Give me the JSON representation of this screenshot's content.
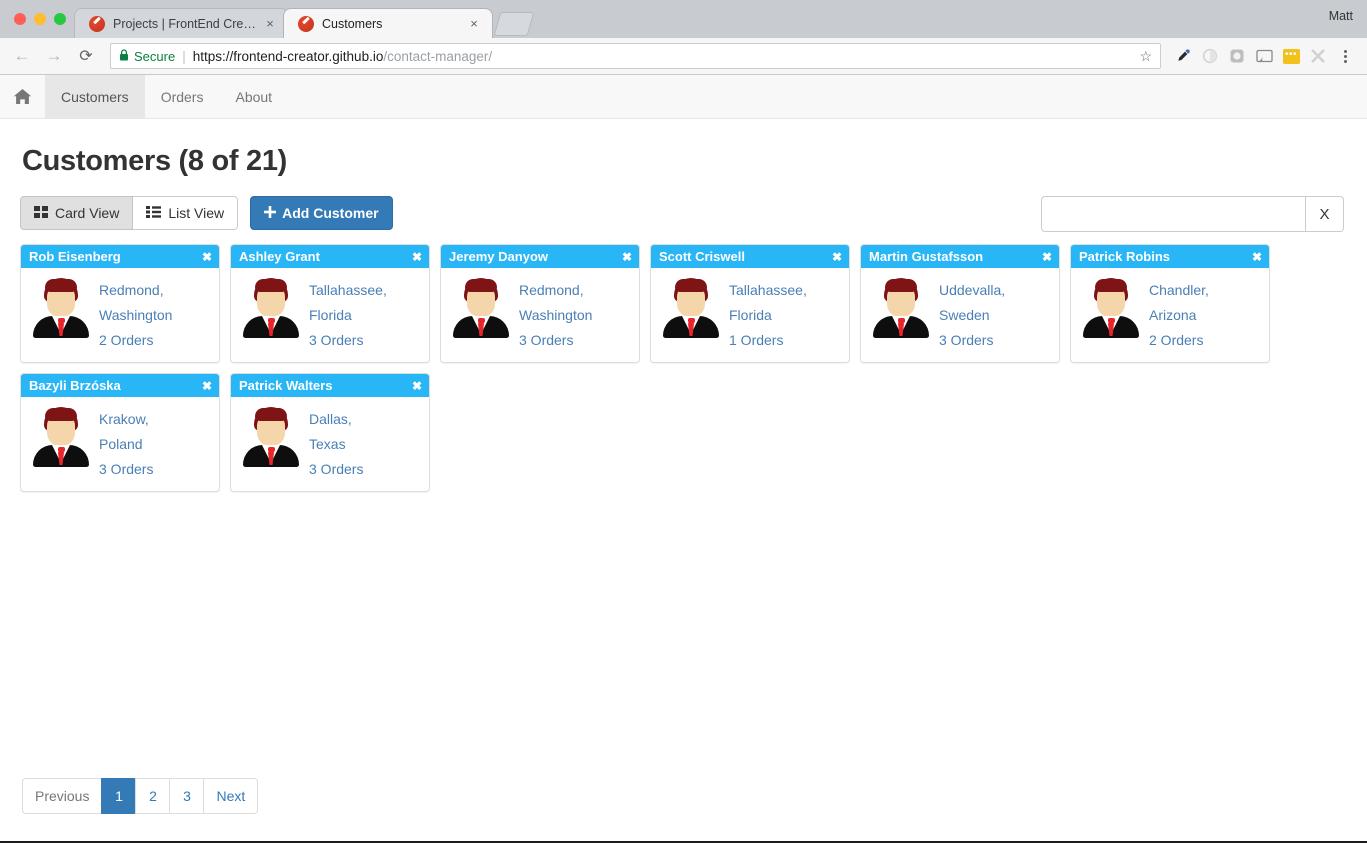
{
  "browser": {
    "user_label": "Matt",
    "tabs": [
      {
        "title": "Projects | FrontEnd Creator",
        "favicon": "aurelia-favicon",
        "close": "×",
        "active": false
      },
      {
        "title": "Customers",
        "favicon": "aurelia-favicon",
        "close": "×",
        "active": true
      }
    ],
    "omnibox": {
      "back_icon": "←",
      "forward_icon": "→",
      "reload_icon": "⟳",
      "lock_icon": "🔒",
      "secure_label": "Secure",
      "separator": "|",
      "url_host": "https://frontend-creator.github.io",
      "url_path": "/contact-manager/",
      "star_icon": "☆",
      "extensions": [
        "eyedropper-icon",
        "circle-icon",
        "square-icon",
        "cast-icon",
        "extension-badge-icon",
        "puzzle-icon"
      ],
      "badge_text": "•••",
      "menu_icon": "kebab-menu-icon"
    }
  },
  "nav": {
    "home_icon": "home-icon",
    "items": [
      {
        "label": "Customers",
        "active": true
      },
      {
        "label": "Orders",
        "active": false
      },
      {
        "label": "About",
        "active": false
      }
    ]
  },
  "main": {
    "title": "Customers (8 of 21)",
    "toolbar": {
      "card_view_label": "Card View",
      "card_view_icon": "grid-icon",
      "list_view_label": "List View",
      "list_view_icon": "list-icon",
      "add_customer_label": "Add Customer",
      "add_customer_icon": "plus-icon"
    },
    "search": {
      "value": "",
      "placeholder": "",
      "clear_label": "X"
    },
    "cards": [
      {
        "name": "Rob Eisenberg",
        "city": "Redmond,",
        "region": "Washington",
        "orders": "2 Orders",
        "close": "✖"
      },
      {
        "name": "Ashley Grant",
        "city": "Tallahassee,",
        "region": "Florida",
        "orders": "3 Orders",
        "close": "✖"
      },
      {
        "name": "Jeremy Danyow",
        "city": "Redmond,",
        "region": "Washington",
        "orders": "3 Orders",
        "close": "✖"
      },
      {
        "name": "Scott Criswell",
        "city": "Tallahassee,",
        "region": "Florida",
        "orders": "1 Orders",
        "close": "✖"
      },
      {
        "name": "Martin Gustafsson",
        "city": "Uddevalla,",
        "region": "Sweden",
        "orders": "3 Orders",
        "close": "✖"
      },
      {
        "name": "Patrick Robins",
        "city": "Chandler,",
        "region": "Arizona",
        "orders": "2 Orders",
        "close": "✖"
      },
      {
        "name": "Bazyli Brzóska",
        "city": "Krakow,",
        "region": "Poland",
        "orders": "3 Orders",
        "close": "✖"
      },
      {
        "name": "Patrick Walters",
        "city": "Dallas,",
        "region": "Texas",
        "orders": "3 Orders",
        "close": "✖"
      }
    ],
    "pagination": [
      {
        "label": "Previous",
        "active": false
      },
      {
        "label": "1",
        "active": true
      },
      {
        "label": "2",
        "active": false
      },
      {
        "label": "3",
        "active": false
      },
      {
        "label": "Next",
        "active": false
      }
    ]
  },
  "colors": {
    "card_header": "#29b6f6",
    "primary_button": "#337ab7",
    "link_text": "#4a7fb5",
    "secure_green": "#0b8043",
    "badge_yellow": "#f2c11c"
  }
}
